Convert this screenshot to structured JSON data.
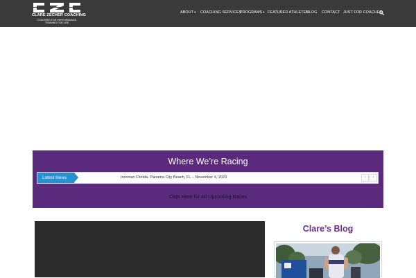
{
  "header": {
    "logo_mark": "CZC",
    "logo_name": "CLARE ZECHER COACHING",
    "logo_tagline_1": "COACHING FOR PERFORMANCE",
    "logo_tagline_2": "TRAINING FOR LIFE",
    "nav": [
      {
        "label": "ABOUT",
        "dropdown": true
      },
      {
        "label": "COACHING SERVICES",
        "dropdown": false
      },
      {
        "label": "PROGRAMS",
        "dropdown": true
      },
      {
        "label": "FEATURED ATHLETES",
        "dropdown": false
      },
      {
        "label": "BLOG",
        "dropdown": false
      },
      {
        "label": "CONTACT",
        "dropdown": false
      },
      {
        "label": "JUST FOR COACHES",
        "dropdown": false
      }
    ],
    "search_icon": "search-icon"
  },
  "racing": {
    "title": "Where We’re Racing",
    "ticker_label": "Latest News",
    "ticker_text": "Ironman Florida, Panama City Beach, FL – November 4, 2023",
    "prev_symbol": "‹",
    "next_symbol": "›",
    "link_text": "Click Here for All Upcoming Races"
  },
  "blog": {
    "title": "Clare’s Blog"
  },
  "colors": {
    "header_bg": "#3a3a3a",
    "banner_purple": "#5a2a7c",
    "ticker_blue": "#2a8fce",
    "blog_title_purple": "#6a2c8a",
    "video_bg": "#2b2b2b"
  }
}
